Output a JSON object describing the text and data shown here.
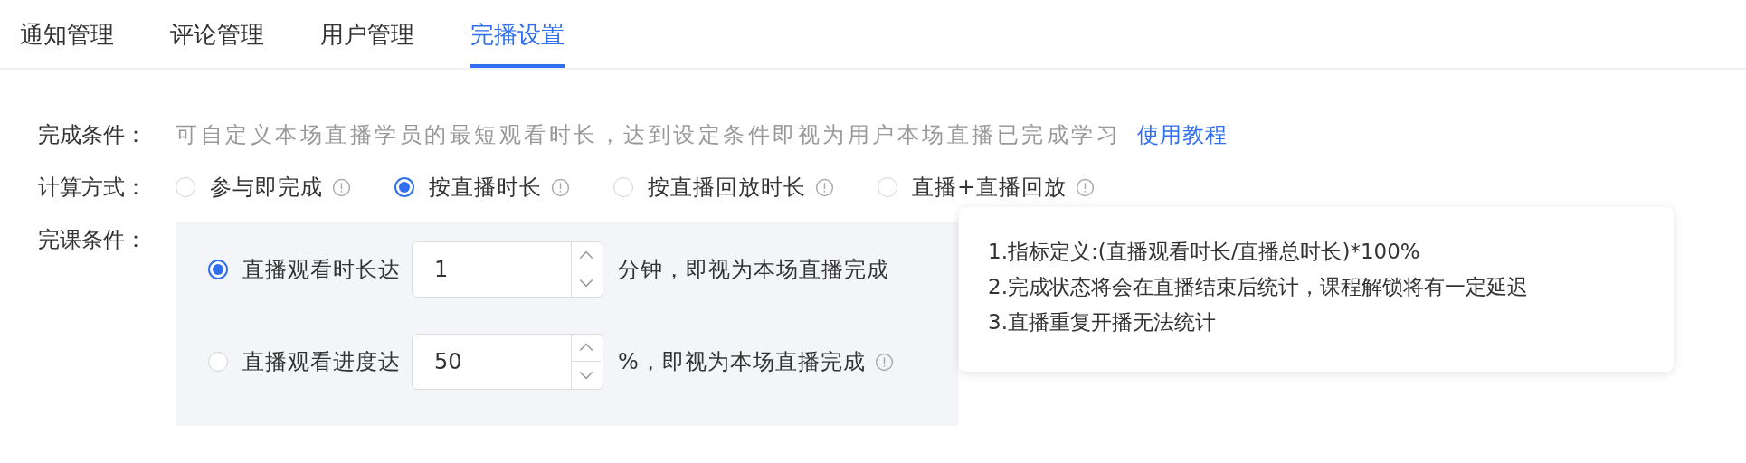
{
  "tabs": [
    {
      "label": "通知管理",
      "selected": false
    },
    {
      "label": "评论管理",
      "selected": false
    },
    {
      "label": "用户管理",
      "selected": false
    },
    {
      "label": "完播设置",
      "selected": true
    }
  ],
  "completion_condition": {
    "label": "完成条件：",
    "description": "可自定义本场直播学员的最短观看时长，达到设定条件即视为用户本场直播已完成学习",
    "link": "使用教程"
  },
  "calculation_method": {
    "label": "计算方式：",
    "options": [
      {
        "label": "参与即完成",
        "selected": false
      },
      {
        "label": "按直播时长",
        "selected": true
      },
      {
        "label": "按直播回放时长",
        "selected": false
      },
      {
        "label": "直播+直播回放",
        "selected": false
      }
    ]
  },
  "course_condition": {
    "label": "完课条件：",
    "options": [
      {
        "prefix": "直播观看时长达",
        "value": "1",
        "suffix": "分钟，即视为本场直播完成",
        "selected": true,
        "info": false
      },
      {
        "prefix": "直播观看进度达",
        "value": "50",
        "suffix": "%，即视为本场直播完成",
        "selected": false,
        "info": true
      }
    ]
  },
  "tooltip": {
    "lines": [
      "1.指标定义:(直播观看时长/直播总时长)*100%",
      "2.完成状态将会在直播结束后统计，课程解锁将有一定延迟",
      "3.直播重复开播无法统计"
    ]
  }
}
